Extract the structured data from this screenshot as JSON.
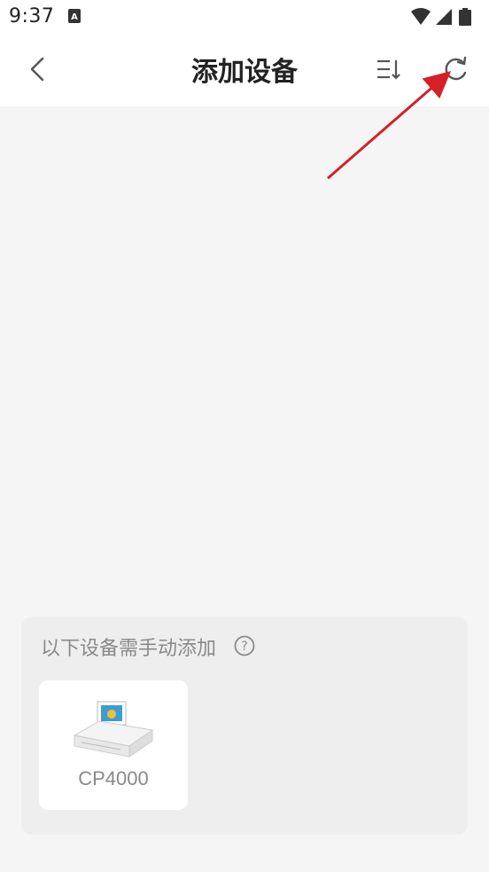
{
  "status_bar": {
    "time": "9:37",
    "icons": [
      "app-a-icon",
      "wifi-icon",
      "cellular-signal-icon",
      "battery-icon"
    ]
  },
  "header": {
    "title": "添加设备",
    "icons": [
      "back-chevron-icon",
      "sort-list-icon",
      "refresh-icon"
    ]
  },
  "manual_section": {
    "title": "以下设备需手动添加",
    "devices": [
      {
        "name": "CP4000",
        "icon": "printer-icon"
      }
    ]
  },
  "colors": {
    "background": "#f5f5f5",
    "panel": "#eeeeee",
    "card": "#ffffff",
    "title_text": "#222222",
    "muted_text": "#8a8a8a",
    "annotation_arrow": "#d61f26"
  }
}
